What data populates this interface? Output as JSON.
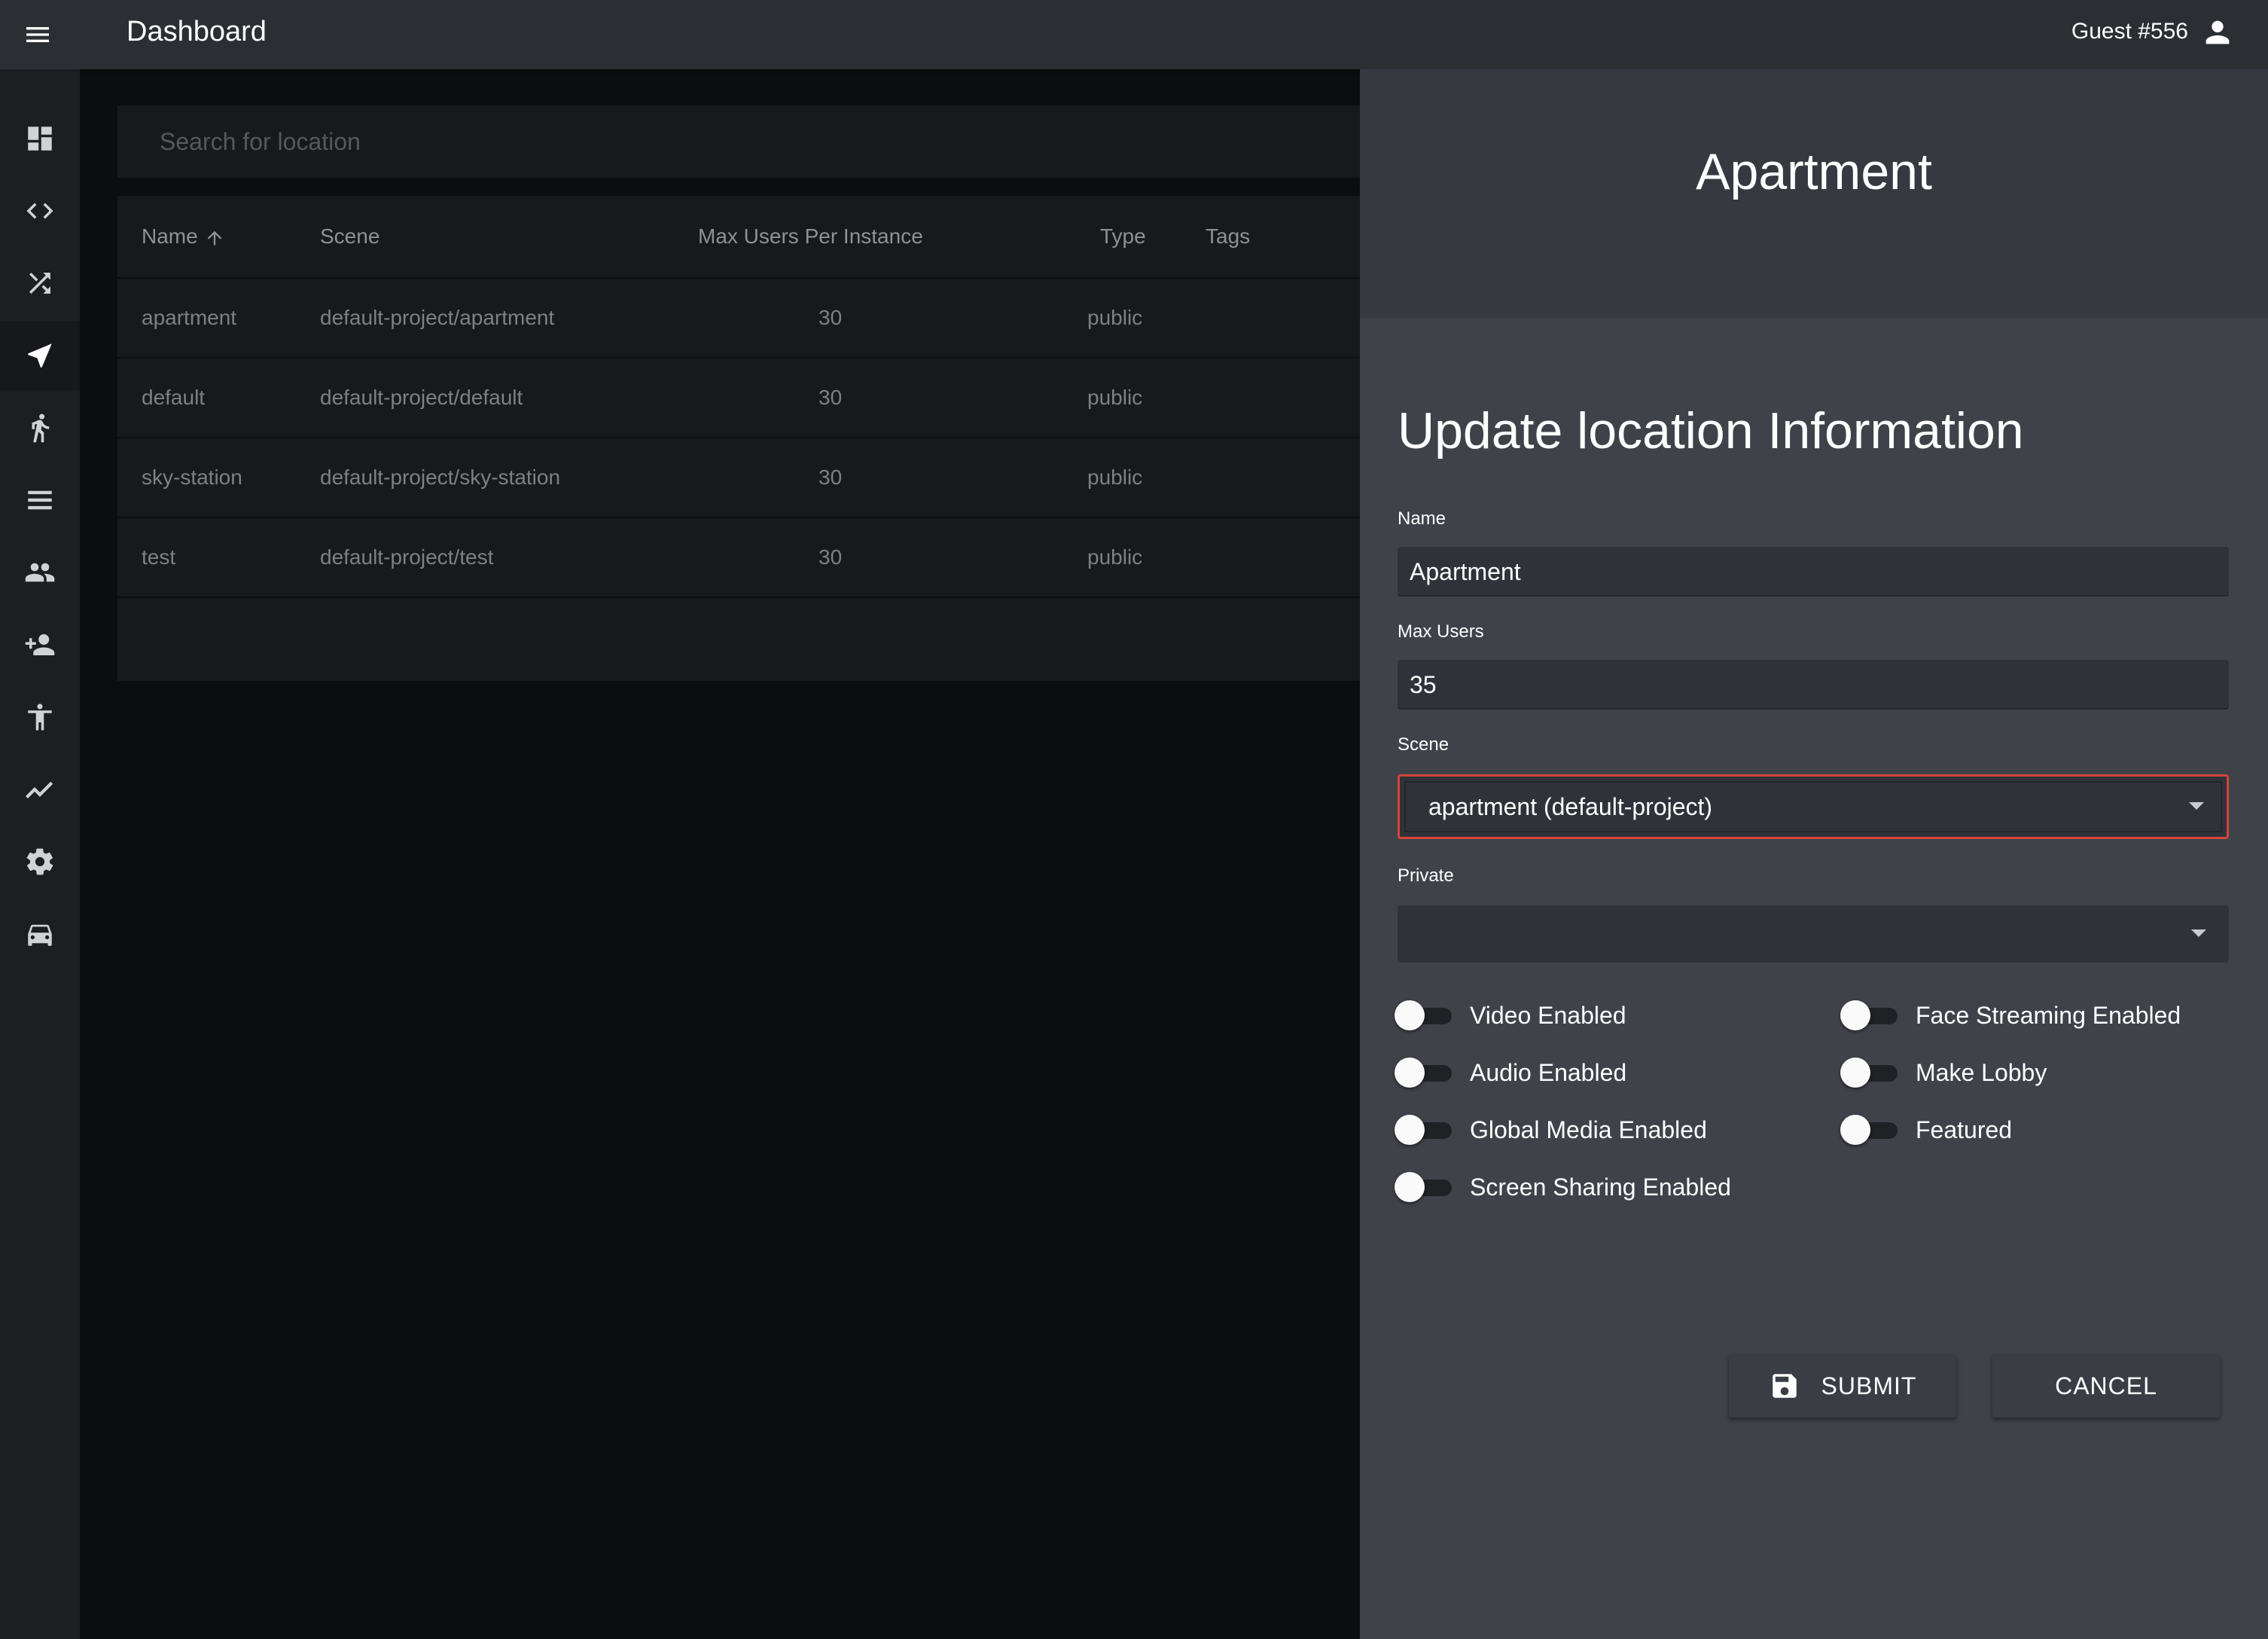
{
  "appbar": {
    "title": "Dashboard",
    "user": "Guest #556"
  },
  "sidebar": {
    "items": [
      {
        "icon": "dashboard-icon"
      },
      {
        "icon": "code-icon"
      },
      {
        "icon": "shuffle-icon"
      },
      {
        "icon": "navigation-icon",
        "active": true
      },
      {
        "icon": "running-icon"
      },
      {
        "icon": "list-icon"
      },
      {
        "icon": "group-icon"
      },
      {
        "icon": "person-add-icon"
      },
      {
        "icon": "accessibility-icon"
      },
      {
        "icon": "trending-icon"
      },
      {
        "icon": "settings-icon"
      },
      {
        "icon": "car-icon"
      }
    ]
  },
  "search": {
    "placeholder": "Search for location"
  },
  "table": {
    "headers": {
      "name": "Name",
      "scene": "Scene",
      "max_users": "Max Users Per Instance",
      "type": "Type",
      "tags": "Tags"
    },
    "rows": [
      {
        "name": "apartment",
        "scene": "default-project/apartment",
        "max_users": "30",
        "type": "public"
      },
      {
        "name": "default",
        "scene": "default-project/default",
        "max_users": "30",
        "type": "public"
      },
      {
        "name": "sky-station",
        "scene": "default-project/sky-station",
        "max_users": "30",
        "type": "public"
      },
      {
        "name": "test",
        "scene": "default-project/test",
        "max_users": "30",
        "type": "public"
      }
    ]
  },
  "drawer": {
    "title": "Apartment",
    "form_title": "Update location Information",
    "name_label": "Name",
    "name_value": "Apartment",
    "max_users_label": "Max Users",
    "max_users_value": "35",
    "scene_label": "Scene",
    "scene_value": "apartment (default-project)",
    "private_label": "Private",
    "private_value": "",
    "switches": {
      "video": {
        "label": "Video Enabled",
        "on": false
      },
      "audio": {
        "label": "Audio Enabled",
        "on": false
      },
      "global_media": {
        "label": "Global Media Enabled",
        "on": false
      },
      "screen_sharing": {
        "label": "Screen Sharing Enabled",
        "on": false
      },
      "face_streaming": {
        "label": "Face Streaming Enabled",
        "on": false
      },
      "make_lobby": {
        "label": "Make Lobby",
        "on": false
      },
      "featured": {
        "label": "Featured",
        "on": false
      }
    },
    "submit_label": "SUBMIT",
    "cancel_label": "CANCEL"
  },
  "colors": {
    "appbar": "#2b2e33",
    "drawer": "#3f4249",
    "error_border": "#d4443b"
  }
}
